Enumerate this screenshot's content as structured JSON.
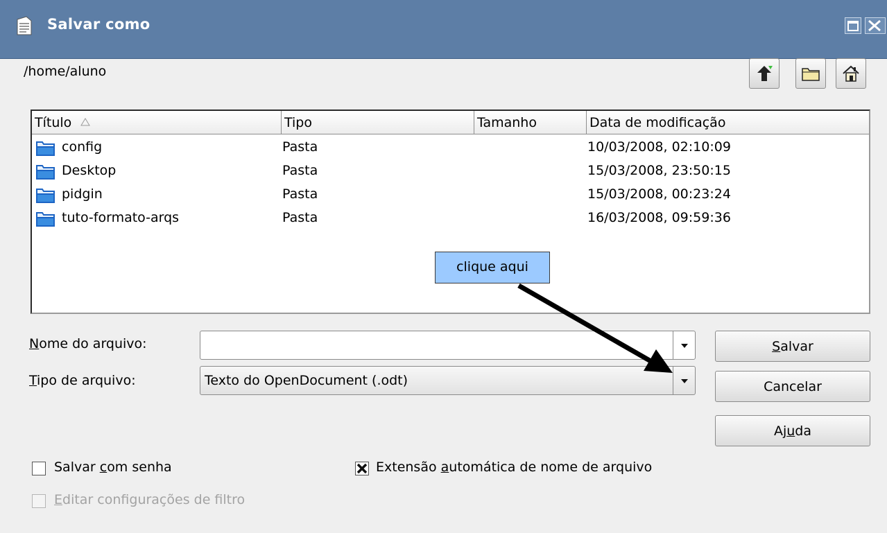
{
  "window": {
    "title": "Salvar como",
    "icons": {
      "app": "document-icon",
      "maximize": "maximize-icon",
      "close": "close-icon"
    }
  },
  "location": {
    "path": "/home/aluno"
  },
  "toolbar": {
    "up_icon": "up-folder-icon",
    "new_folder_icon": "new-folder-icon",
    "home_icon": "home-icon"
  },
  "file_list": {
    "columns": [
      "Título",
      "Tipo",
      "Tamanho",
      "Data de modificação"
    ],
    "rows": [
      {
        "name": "config",
        "type": "Pasta",
        "size": "",
        "modified": "10/03/2008, 02:10:09"
      },
      {
        "name": "Desktop",
        "type": "Pasta",
        "size": "",
        "modified": "15/03/2008, 23:50:15"
      },
      {
        "name": "pidgin",
        "type": "Pasta",
        "size": "",
        "modified": "15/03/2008, 00:23:24"
      },
      {
        "name": "tuto-formato-arqs",
        "type": "Pasta",
        "size": "",
        "modified": "16/03/2008, 09:59:36"
      }
    ]
  },
  "form": {
    "filename_label_u": "N",
    "filename_label_rest": "ome do arquivo:",
    "filename_value": "",
    "filetype_label_u": "T",
    "filetype_label_rest": "ipo de arquivo:",
    "filetype_value": "Texto do OpenDocument (.odt)"
  },
  "buttons": {
    "save_u": "S",
    "save_rest": "alvar",
    "cancel": "Cancelar",
    "help_pre": "Aj",
    "help_u": "u",
    "help_post": "da"
  },
  "options": {
    "password_pre": "Salvar ",
    "password_u": "c",
    "password_post": "om senha",
    "password_checked": false,
    "autoext_pre": "Extensão ",
    "autoext_u": "a",
    "autoext_post": "utomática de nome de arquivo",
    "autoext_checked": true,
    "filter_u": "E",
    "filter_post": "ditar configurações de filtro",
    "filter_enabled": false
  },
  "annotation": {
    "text": "clique aqui",
    "color": "#9ccaff"
  },
  "colors": {
    "titlebar": "#5d7ea6",
    "folder": "#3a8de0"
  }
}
